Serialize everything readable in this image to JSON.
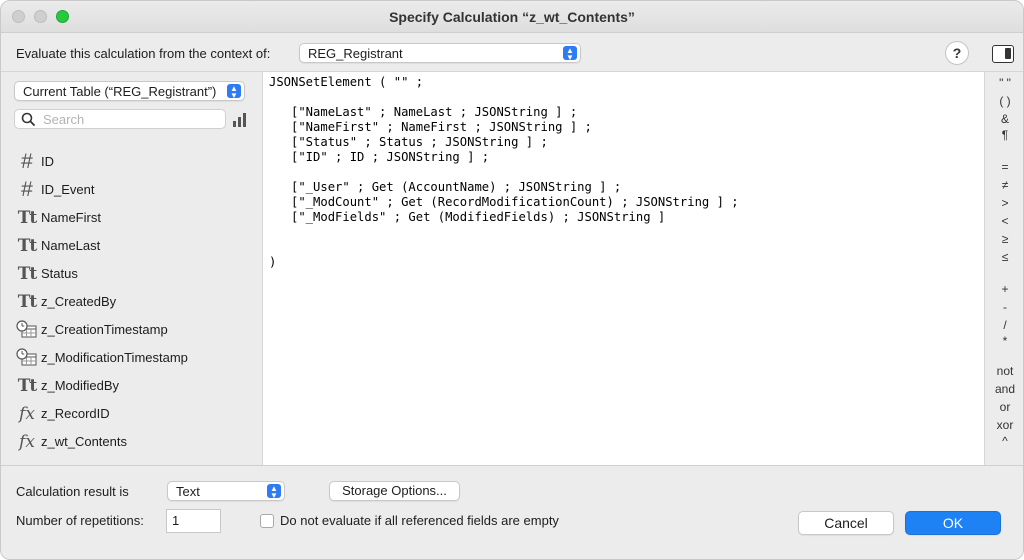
{
  "window": {
    "title": "Specify Calculation “z_wt_Contents”"
  },
  "context": {
    "label": "Evaluate this calculation from the context of:",
    "selected": "REG_Registrant",
    "help_label": "?"
  },
  "fields_panel": {
    "table_selected": "Current Table (“REG_Registrant”)",
    "search_placeholder": "Search",
    "fields": [
      {
        "label": "ID",
        "type": "number",
        "icon": "hash-icon"
      },
      {
        "label": "ID_Event",
        "type": "number",
        "icon": "hash-icon"
      },
      {
        "label": "NameFirst",
        "type": "text",
        "icon": "text-type-icon"
      },
      {
        "label": "NameLast",
        "type": "text",
        "icon": "text-type-icon"
      },
      {
        "label": "Status",
        "type": "text",
        "icon": "text-type-icon"
      },
      {
        "label": "z_CreatedBy",
        "type": "text",
        "icon": "text-type-icon"
      },
      {
        "label": "z_CreationTimestamp",
        "type": "timestamp",
        "icon": "timestamp-icon"
      },
      {
        "label": "z_ModificationTimestamp",
        "type": "timestamp",
        "icon": "timestamp-icon"
      },
      {
        "label": "z_ModifiedBy",
        "type": "text",
        "icon": "text-type-icon"
      },
      {
        "label": "z_RecordID",
        "type": "calculation",
        "icon": "fx-icon"
      },
      {
        "label": "z_wt_Contents",
        "type": "calculation",
        "icon": "fx-icon"
      }
    ]
  },
  "editor": {
    "formula": "JSONSetElement ( \"\" ;\n\n   [\"NameLast\" ; NameLast ; JSONString ] ;\n   [\"NameFirst\" ; NameFirst ; JSONString ] ;\n   [\"Status\" ; Status ; JSONString ] ;\n   [\"ID\" ; ID ; JSONString ] ;\n\n   [\"_User\" ; Get (AccountName) ; JSONString ] ;\n   [\"_ModCount\" ; Get (RecordModificationCount) ; JSONString ] ;\n   [\"_ModFields\" ; Get (ModifiedFields) ; JSONString ]\n\n\n)"
  },
  "operators": [
    "\" \"",
    "( )",
    "&",
    "¶",
    "=",
    "≠",
    ">",
    "<",
    "≥",
    "≤",
    "+",
    "-",
    "/",
    "*",
    "not",
    "and",
    "or",
    "xor",
    "^"
  ],
  "bottom": {
    "result_label": "Calculation result is",
    "result_selected": "Text",
    "storage_button": "Storage Options...",
    "repetitions_label": "Number of repetitions:",
    "repetitions_value": "1",
    "checkbox_label": "Do not evaluate if all referenced fields are empty",
    "checkbox_checked": false,
    "cancel_button": "Cancel",
    "ok_button": "OK"
  },
  "colors": {
    "accent": "#1e82f5",
    "zoom_button": "#27c93f"
  }
}
